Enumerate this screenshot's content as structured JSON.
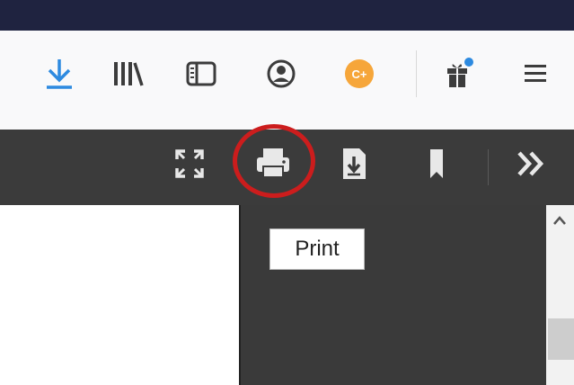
{
  "colors": {
    "titlebar": "#1f2340",
    "navbar": "#f9f9fa",
    "pdf_toolbar": "#3b3b3b",
    "highlight": "#cc1d1d",
    "download_accent": "#2d8ae0",
    "avatar_accent": "#f6a63a"
  },
  "toolbar": {
    "icons": [
      "download-icon",
      "library-icon",
      "sidebar-icon",
      "account-icon",
      "extension-icon",
      "whats-new-icon",
      "menu-icon"
    ],
    "extension_badge": "C+"
  },
  "pdf_toolbar": {
    "icons": [
      "presentation-mode-icon",
      "print-icon",
      "save-icon",
      "bookmark-icon",
      "more-tools-icon"
    ]
  },
  "tooltip": {
    "text": "Print"
  }
}
